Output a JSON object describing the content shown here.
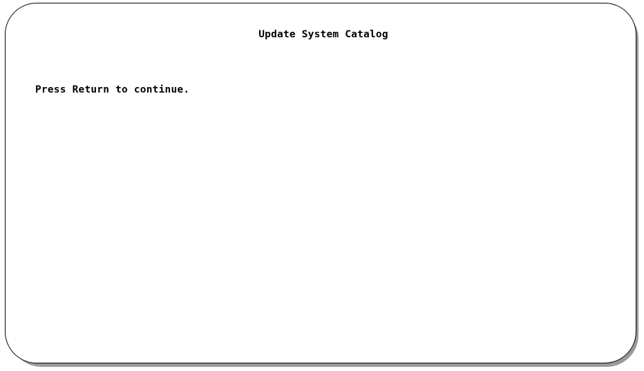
{
  "screen": {
    "title": "Update System Catalog",
    "prompt": "Press Return to continue."
  }
}
